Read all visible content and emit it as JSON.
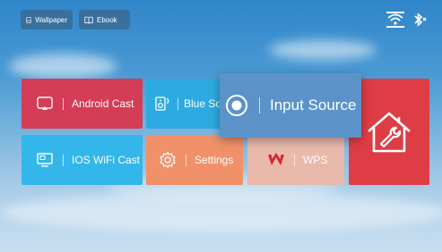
{
  "topbar": {
    "wallpaper_label": "Wallpaper",
    "ebook_label": "Ebook"
  },
  "status_icons": [
    "wifi-icon",
    "bluetooth-icon"
  ],
  "tiles": {
    "android_cast": {
      "label": "Android Cast",
      "color": "#d53c56"
    },
    "bluetooth": {
      "label": "Blue So",
      "color": "#2eaae2"
    },
    "ios_wifi_cast": {
      "label": "IOS WiFi Cast",
      "color": "#33b6ea"
    },
    "settings": {
      "label": "Settings",
      "color": "#f0916a"
    },
    "wps": {
      "label": "WPS",
      "color": "#e9b9ac"
    },
    "tools": {
      "color": "#de3d46"
    }
  },
  "focused_overlay": {
    "label": "Input Source",
    "color": "#5b93c9"
  }
}
